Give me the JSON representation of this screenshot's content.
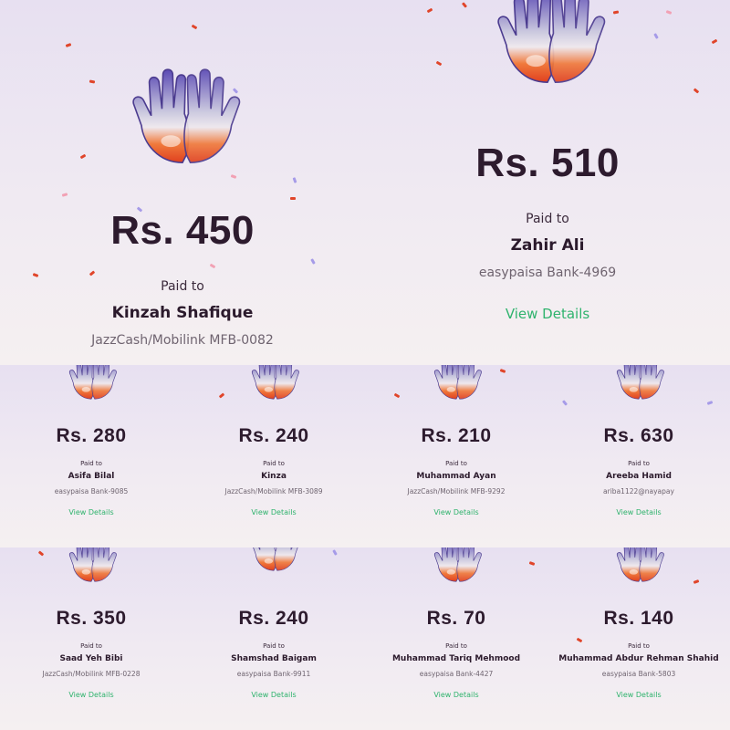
{
  "colors": {
    "accent_green": "#2fb36d",
    "text_dark": "#2d1b2e",
    "confetti_red": "#e0452a",
    "confetti_pink": "#f2a1b4",
    "confetti_purple": "#a69be8"
  },
  "icon": "praying-hands-3d-icon",
  "cards": [
    {
      "amount": "Rs. 450",
      "paid_to": "Paid to",
      "name": "Kinzah Shafique",
      "account": "JazzCash/Mobilink MFB-0082",
      "view": ""
    },
    {
      "amount": "Rs. 510",
      "paid_to": "Paid to",
      "name": "Zahir Ali",
      "account": "easypaisa Bank-4969",
      "view": "View Details"
    },
    {
      "amount": "Rs. 280",
      "paid_to": "Paid to",
      "name": "Asifa Bilal",
      "account": "easypaisa Bank-9085",
      "view": "View Details"
    },
    {
      "amount": "Rs. 240",
      "paid_to": "Paid to",
      "name": "Kinza",
      "account": "JazzCash/Mobilink MFB-3089",
      "view": "View Details"
    },
    {
      "amount": "Rs. 210",
      "paid_to": "Paid to",
      "name": "Muhammad Ayan",
      "account": "JazzCash/Mobilink MFB-9292",
      "view": "View Details"
    },
    {
      "amount": "Rs. 630",
      "paid_to": "Paid to",
      "name": "Areeba Hamid",
      "account": "ariba1122@nayapay",
      "view": "View Details"
    },
    {
      "amount": "Rs. 350",
      "paid_to": "Paid to",
      "name": "Saad Yeh Bibi",
      "account": "JazzCash/Mobilink MFB-0228",
      "view": "View Details"
    },
    {
      "amount": "Rs. 240",
      "paid_to": "Paid to",
      "name": "Shamshad Baigam",
      "account": "easypaisa Bank-9911",
      "view": "View Details"
    },
    {
      "amount": "Rs. 70",
      "paid_to": "Paid to",
      "name": "Muhammad Tariq Mehmood",
      "account": "easypaisa Bank-4427",
      "view": "View Details"
    },
    {
      "amount": "Rs. 140",
      "paid_to": "Paid to",
      "name": "Muhammad Abdur Rehman Shahid",
      "account": "easypaisa Bank-5803",
      "view": "View Details"
    }
  ]
}
